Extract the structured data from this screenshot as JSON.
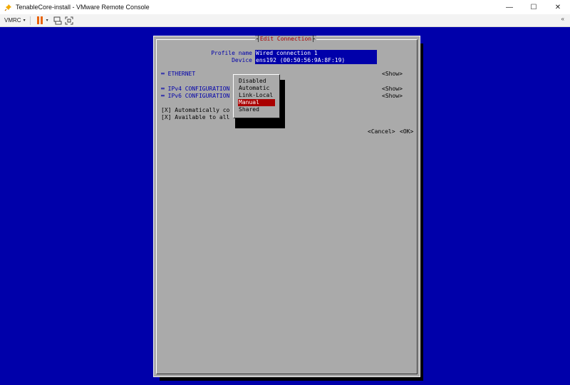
{
  "window": {
    "title": "TenableCore-install - VMware Remote Console",
    "controls": {
      "minimize": "—",
      "maximize": "☐",
      "close": "✕"
    }
  },
  "toolbar": {
    "vmrc_label": "VMRC",
    "caret": "▾",
    "pause_caret": "▾",
    "collapse": "«"
  },
  "dialog": {
    "title": "Edit Connection",
    "profile_name_label": "Profile name",
    "profile_name_value": "Wired connection 1",
    "device_label": "Device",
    "device_value": "ens192 (00:50:56:9A:8F:19)",
    "sections": [
      {
        "label": "═ ETHERNET",
        "show": "<Show>"
      },
      {
        "label": "═ IPv4 CONFIGURATION",
        "show": "<Show>"
      },
      {
        "label": "═ IPv6 CONFIGURATION",
        "show": "<Show>"
      }
    ],
    "checkboxes": [
      "[X] Automatically co",
      "[X] Available to all"
    ],
    "cancel": "<Cancel>",
    "ok": "<OK>"
  },
  "popup": {
    "options": [
      "Disabled",
      "Automatic",
      "Link-Local",
      "Manual",
      "Shared"
    ],
    "selected": "Manual"
  },
  "colors": {
    "console_bg": "#0000aa",
    "dialog_bg": "#aaaaaa",
    "title_red": "#aa0000",
    "selected_bg": "#aa0000",
    "pause_orange": "#e8630a"
  }
}
